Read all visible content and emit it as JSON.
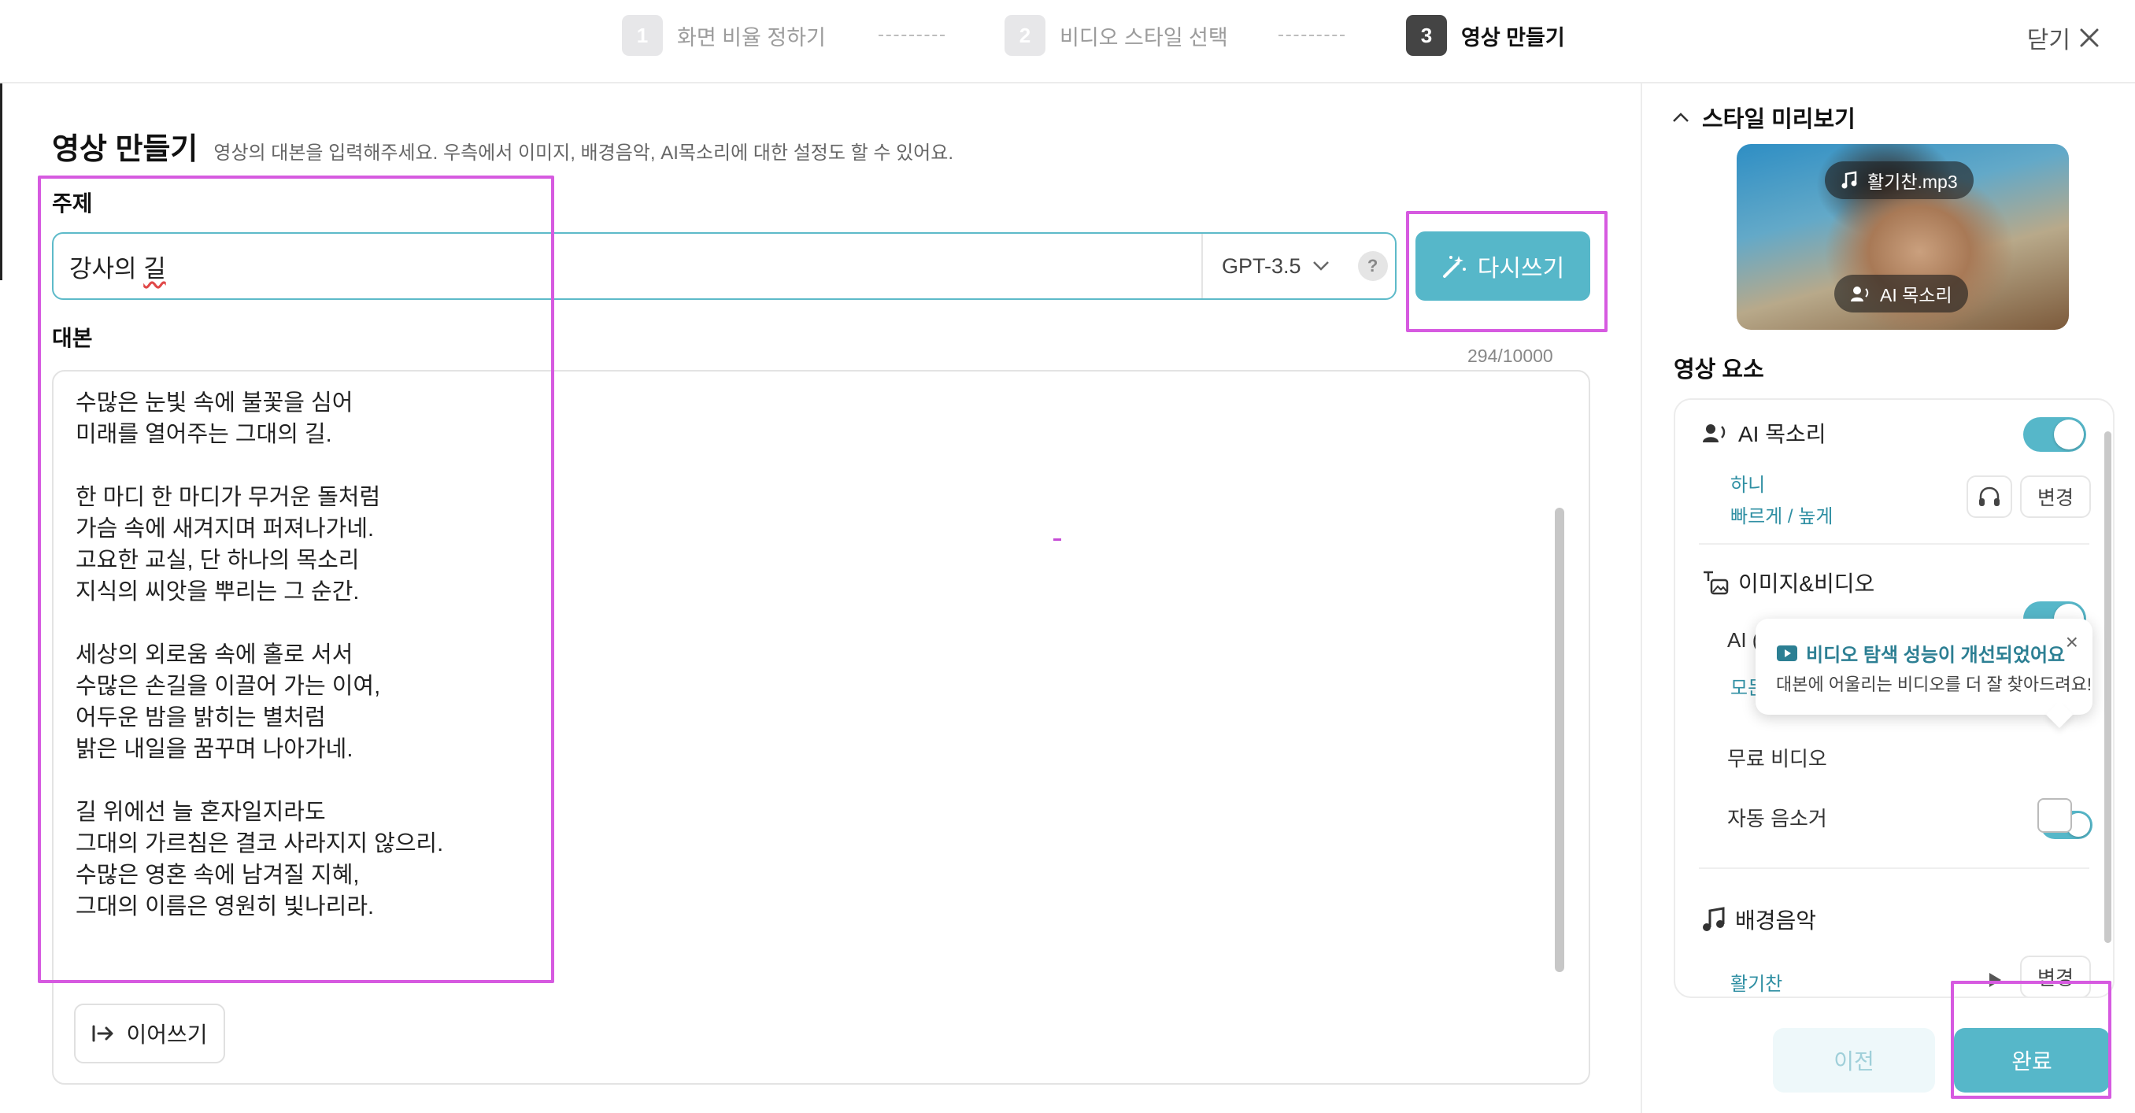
{
  "stepper": {
    "steps": [
      {
        "num": "1",
        "label": "화면 비율 정하기"
      },
      {
        "num": "2",
        "label": "비디오 스타일 선택"
      },
      {
        "num": "3",
        "label": "영상 만들기"
      }
    ],
    "close_label": "닫기"
  },
  "main": {
    "title": "영상 만들기",
    "subtitle": "영상의 대본을 입력해주세요. 우측에서 이미지, 배경음악, AI목소리에 대한 설정도 할 수 있어요.",
    "topic_label": "주제",
    "topic_prefix": "강사의 ",
    "topic_misspelled": "길",
    "model": "GPT-3.5",
    "help": "?",
    "rewrite_label": "다시쓰기",
    "script_label": "대본",
    "char_count": "294/10000",
    "script": "수많은 눈빛 속에 불꽃을 심어\n미래를 열어주는 그대의 길.\n\n한 마디 한 마디가 무거운 돌처럼\n가슴 속에 새겨지며 퍼져나가네.\n고요한 교실, 단 하나의 목소리\n지식의 씨앗을 뿌리는 그 순간.\n\n세상의 외로움 속에 홀로 서서\n수많은 손길을 이끌어 가는 이여,\n어두운 밤을 밝히는 별처럼\n밝은 내일을 꿈꾸며 나아가네.\n\n길 위에선 늘 혼자일지라도\n그대의 가르침은 결코 사라지지 않으리.\n수많은 영혼 속에 남겨질 지혜,\n그대의 이름은 영원히 빛나리라.",
    "continue_label": "이어쓰기"
  },
  "panel": {
    "preview_title": "스타일 미리보기",
    "preview_music_chip": "활기찬.mp3",
    "preview_voice_chip": "AI 목소리",
    "elements_title": "영상 요소",
    "voice": {
      "title": "AI 목소리",
      "name": "하니",
      "settings": "빠르게 / 높게",
      "change": "변경"
    },
    "image_video": {
      "title": "이미지&비디오",
      "ai_partial": "AI (",
      "link_partial": "모든",
      "free_video": "무료 비디오",
      "auto_mute": "자동 음소거"
    },
    "tooltip": {
      "title": "비디오 탐색 성능이 개선되었어요",
      "body": "대본에 어울리는 비디오를 더 잘 찾아드려요!",
      "close": "×"
    },
    "music": {
      "title": "배경음악",
      "name": "활기찬",
      "change": "변경"
    },
    "prev_label": "이전",
    "done_label": "완료"
  },
  "colors": {
    "accent": "#56b7c9",
    "annotation": "#d65ae0"
  }
}
